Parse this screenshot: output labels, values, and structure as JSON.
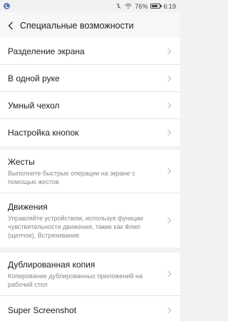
{
  "status_bar": {
    "battery": "76%",
    "battery_level": 0.76,
    "time": "6:19",
    "icons": [
      "notification-icon",
      "mute-icon",
      "wifi-icon",
      "battery-icon"
    ]
  },
  "header": {
    "title": "Специальные возможности",
    "back_icon": "chevron-left-icon"
  },
  "groups": [
    {
      "items": [
        {
          "title": "Разделение экрана"
        },
        {
          "title": "В одной руке"
        },
        {
          "title": "Умный чехол"
        },
        {
          "title": "Настройка кнопок"
        }
      ]
    },
    {
      "items": [
        {
          "title": "Жесты",
          "subtitle_lines": [
            "Выполните быстрые операции на экране с",
            "помощью жестов"
          ]
        },
        {
          "title": "Движения",
          "subtitle_lines": [
            "Управляйте устройством, используя функции",
            "чувствительности движения, такие как Флип",
            "(щелчок), Встряхивание"
          ]
        }
      ]
    },
    {
      "items": [
        {
          "title": "Дублированная копия",
          "subtitle_lines": [
            "Копирование дублированных приложений на",
            "рабочий стол"
          ]
        },
        {
          "title": "Super Screenshot"
        }
      ]
    }
  ]
}
